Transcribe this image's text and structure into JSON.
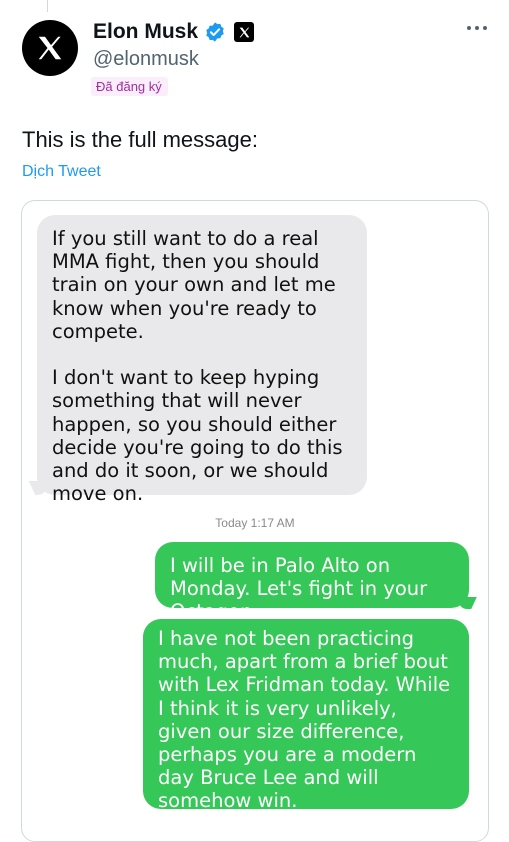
{
  "author": {
    "name": "Elon Musk",
    "handle": "@elonmusk",
    "subscribed_label": "Đã đăng ký",
    "verified_icon": "verified-badge-icon",
    "affiliate_icon": "x-logo-icon"
  },
  "tweet": {
    "text": "This is the full message:",
    "translate_label": "Dịch Tweet"
  },
  "conversation": {
    "incoming": "If you still want to do a real MMA fight, then you should train on your own and let me know when you're ready to compete.\n\nI don't want to keep hyping something that will never happen, so you should either decide you're going to do this and do it soon, or we should move on.",
    "timestamp": "Today 1:17 AM",
    "outgoing": [
      "I will be in Palo Alto on Monday. Let's fight in your Octagon.",
      "I have not been practicing much, apart from a brief bout with Lex Fridman today. While I think it is very unlikely, given our size difference, perhaps you are a modern day Bruce Lee and will somehow win."
    ]
  },
  "colors": {
    "imessage_green": "#35c758",
    "incoming_gray": "#e9e9eb",
    "link_blue": "#1d9bf0",
    "verified_blue": "#1d9bf0"
  }
}
